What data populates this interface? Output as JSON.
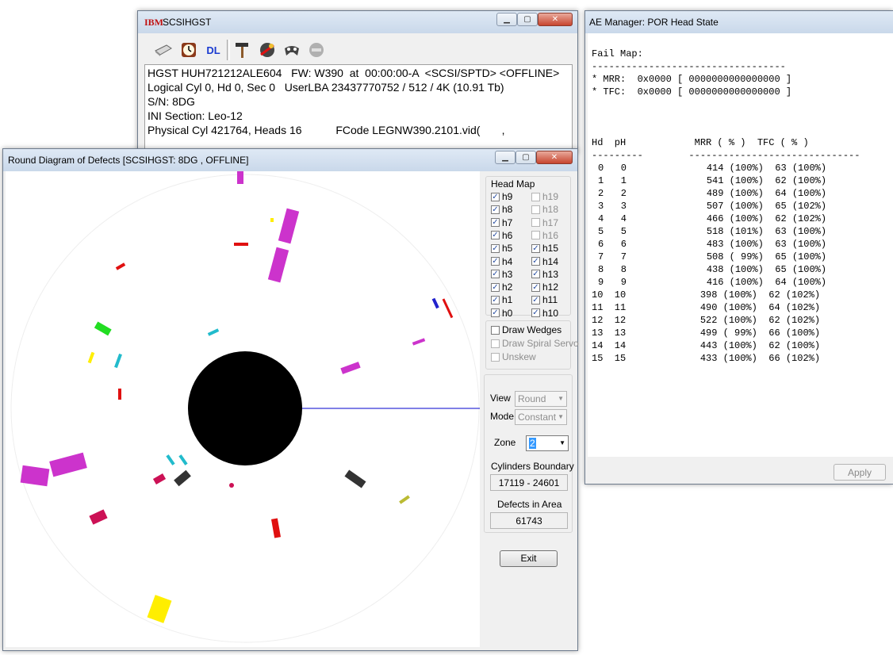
{
  "scsi_window": {
    "logo": "IBM",
    "title": "SCSIHGST",
    "toolbar": {
      "dl_label": "DL"
    },
    "info_lines": [
      "HGST HUH721212ALE604   FW: W390  at  00:00:00-A  <SCSI/SPTD> <OFFLINE>",
      "Logical Cyl 0, Hd 0, Sec 0   UserLBA 23437770752 / 512 / 4K (10.91 Tb)",
      "S/N: 8DG",
      "INI Section: Leo-12",
      "Physical Cyl 421764, Heads 16           FCode LEGNW390.2101.vid(       ,"
    ]
  },
  "ae_window": {
    "title": "AE Manager: POR Head State",
    "fail_map_label": "Fail Map:",
    "separator": "----------------------------------",
    "mrr_line": "* MRR:  0x0000 [ 0000000000000000 ]",
    "tfc_line": "* TFC:  0x0000 [ 0000000000000000 ]",
    "table_header": "Hd  pH            MRR ( % )  TFC ( % )",
    "table_dashes": "---------        ------------------------------",
    "rows": [
      "0   0              414 (100%)  63 (100%)",
      "1   1              541 (100%)  62 (100%)",
      "2   2              489 (100%)  64 (100%)",
      "3   3              507 (100%)  65 (102%)",
      "4   4              466 (100%)  62 (102%)",
      "5   5              518 (101%)  63 (100%)",
      "6   6              483 (100%)  63 (100%)",
      "7   7              508 ( 99%)  65 (100%)",
      "8   8              438 (100%)  65 (100%)",
      "9   9              416 (100%)  64 (100%)",
      "10  10             398 (100%)  62 (102%)",
      "11  11             490 (100%)  64 (102%)",
      "12  12             522 (100%)  62 (102%)",
      "13  13             499 ( 99%)  66 (100%)",
      "14  14             443 (100%)  62 (100%)",
      "15  15             433 (100%)  66 (102%)"
    ],
    "apply_label": "Apply"
  },
  "round_window": {
    "title": "Round Diagram of Defects [SCSIHGST: 8DG          , OFFLINE]",
    "head_map_label": "Head Map",
    "heads_left": [
      {
        "label": "h9",
        "checked": true,
        "enabled": true
      },
      {
        "label": "h8",
        "checked": true,
        "enabled": true
      },
      {
        "label": "h7",
        "checked": true,
        "enabled": true
      },
      {
        "label": "h6",
        "checked": true,
        "enabled": true
      },
      {
        "label": "h5",
        "checked": true,
        "enabled": true
      },
      {
        "label": "h4",
        "checked": true,
        "enabled": true
      },
      {
        "label": "h3",
        "checked": true,
        "enabled": true
      },
      {
        "label": "h2",
        "checked": true,
        "enabled": true
      },
      {
        "label": "h1",
        "checked": true,
        "enabled": true
      },
      {
        "label": "h0",
        "checked": true,
        "enabled": true
      }
    ],
    "heads_right": [
      {
        "label": "h19",
        "checked": false,
        "enabled": false
      },
      {
        "label": "h18",
        "checked": false,
        "enabled": false
      },
      {
        "label": "h17",
        "checked": false,
        "enabled": false
      },
      {
        "label": "h16",
        "checked": false,
        "enabled": false
      },
      {
        "label": "h15",
        "checked": true,
        "enabled": true
      },
      {
        "label": "h14",
        "checked": true,
        "enabled": true
      },
      {
        "label": "h13",
        "checked": true,
        "enabled": true
      },
      {
        "label": "h12",
        "checked": true,
        "enabled": true
      },
      {
        "label": "h11",
        "checked": true,
        "enabled": true
      },
      {
        "label": "h10",
        "checked": true,
        "enabled": true
      }
    ],
    "options": [
      {
        "label": "Draw Wedges",
        "checked": false,
        "enabled": true
      },
      {
        "label": "Draw Spiral Servo",
        "checked": false,
        "enabled": false
      },
      {
        "label": "Unskew",
        "checked": false,
        "enabled": false
      }
    ],
    "view_label": "View",
    "view_value": "Round",
    "mode_label": "Mode",
    "mode_value": "Constant",
    "zone_label": "Zone",
    "zone_value": "2",
    "cylinders_label": "Cylinders Boundary",
    "cylinders_value": "17119 - 24601",
    "defects_label": "Defects in Area",
    "defects_value": "61743",
    "exit_label": "Exit"
  },
  "colors": {
    "disk": "#ffffff",
    "hub": "#000000",
    "index_line": "#0000cc",
    "defect_magenta": "#cc33cc",
    "defect_red": "#e01010",
    "defect_green": "#22dd22",
    "defect_cyan": "#22bbcc",
    "defect_yellow": "#ffee00",
    "defect_crimson": "#cc1155",
    "defect_gray": "#333333",
    "defect_olive": "#bbbb33",
    "defect_blue": "#2222cc"
  }
}
